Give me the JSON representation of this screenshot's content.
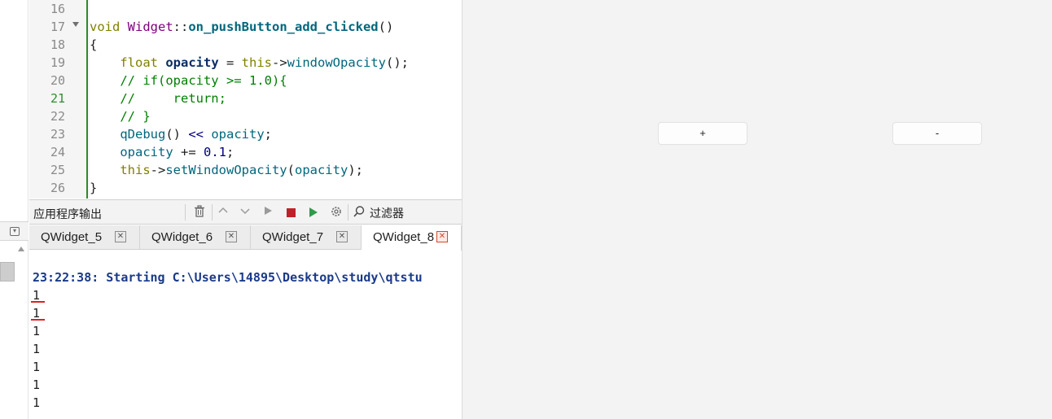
{
  "editor": {
    "lines": [
      {
        "number": "16",
        "current": false,
        "tokens": []
      },
      {
        "number": "17",
        "current": false,
        "tokens": [
          {
            "t": "void",
            "c": "kw"
          },
          {
            "t": " ",
            "c": "pl"
          },
          {
            "t": "Widget",
            "c": "ty"
          },
          {
            "t": "::",
            "c": "pl"
          },
          {
            "t": "on_pushButton_add_clicked",
            "c": "fn"
          },
          {
            "t": "()",
            "c": "pl"
          }
        ]
      },
      {
        "number": "18",
        "current": false,
        "tokens": [
          {
            "t": "{",
            "c": "pl"
          }
        ]
      },
      {
        "number": "19",
        "current": false,
        "tokens": [
          {
            "t": "    ",
            "c": "pl"
          },
          {
            "t": "float",
            "c": "kw"
          },
          {
            "t": " ",
            "c": "pl"
          },
          {
            "t": "opacity",
            "c": "vr"
          },
          {
            "t": " = ",
            "c": "pl"
          },
          {
            "t": "this",
            "c": "kw"
          },
          {
            "t": "->",
            "c": "pl"
          },
          {
            "t": "windowOpacity",
            "c": "mt"
          },
          {
            "t": "();",
            "c": "pl"
          }
        ]
      },
      {
        "number": "20",
        "current": false,
        "tokens": [
          {
            "t": "    // if(opacity >= 1.0){",
            "c": "cm"
          }
        ]
      },
      {
        "number": "21",
        "current": true,
        "tokens": [
          {
            "t": "    //     return;",
            "c": "cm"
          }
        ]
      },
      {
        "number": "22",
        "current": false,
        "tokens": [
          {
            "t": "    // }",
            "c": "cm"
          }
        ]
      },
      {
        "number": "23",
        "current": false,
        "tokens": [
          {
            "t": "    ",
            "c": "pl"
          },
          {
            "t": "qDebug",
            "c": "mt"
          },
          {
            "t": "() ",
            "c": "pl"
          },
          {
            "t": "<<",
            "c": "num"
          },
          {
            "t": " ",
            "c": "pl"
          },
          {
            "t": "opacity",
            "c": "mt"
          },
          {
            "t": ";",
            "c": "pl"
          }
        ]
      },
      {
        "number": "24",
        "current": false,
        "tokens": [
          {
            "t": "    ",
            "c": "pl"
          },
          {
            "t": "opacity",
            "c": "mt"
          },
          {
            "t": " += ",
            "c": "pl"
          },
          {
            "t": "0.1",
            "c": "num"
          },
          {
            "t": ";",
            "c": "pl"
          }
        ]
      },
      {
        "number": "25",
        "current": false,
        "tokens": [
          {
            "t": "    ",
            "c": "pl"
          },
          {
            "t": "this",
            "c": "kw"
          },
          {
            "t": "->",
            "c": "pl"
          },
          {
            "t": "setWindowOpacity",
            "c": "mt"
          },
          {
            "t": "(",
            "c": "pl"
          },
          {
            "t": "opacity",
            "c": "mt"
          },
          {
            "t": ");",
            "c": "pl"
          }
        ]
      },
      {
        "number": "26",
        "current": false,
        "tokens": [
          {
            "t": "}",
            "c": "pl"
          }
        ]
      }
    ]
  },
  "output_toolbar": {
    "title": "应用程序输出",
    "filter_label": "过滤器",
    "icons": [
      "trash-icon",
      "arrow-up-icon",
      "arrow-down-icon",
      "run-icon",
      "stop-icon",
      "run-debug-icon",
      "gear-icon",
      "search-icon"
    ]
  },
  "tabs": [
    {
      "label": "QWidget_5",
      "active": false
    },
    {
      "label": "QWidget_6",
      "active": false
    },
    {
      "label": "QWidget_7",
      "active": false
    },
    {
      "label": "QWidget_8",
      "active": true
    }
  ],
  "console": {
    "start_line": "23:22:38: Starting C:\\Users\\14895\\Desktop\\study\\qtstu",
    "output_lines": [
      "1",
      "1",
      "1",
      "1",
      "1",
      "1",
      "1"
    ],
    "marked_lines": [
      0,
      1
    ]
  },
  "app_window": {
    "add_button_label": "+",
    "sub_button_label": "-"
  },
  "colors": {
    "change_bar": "#2b8a2b",
    "stop_red": "#c0202a",
    "mark_red": "#e02020",
    "active_tab_close": "#d04a2a"
  }
}
